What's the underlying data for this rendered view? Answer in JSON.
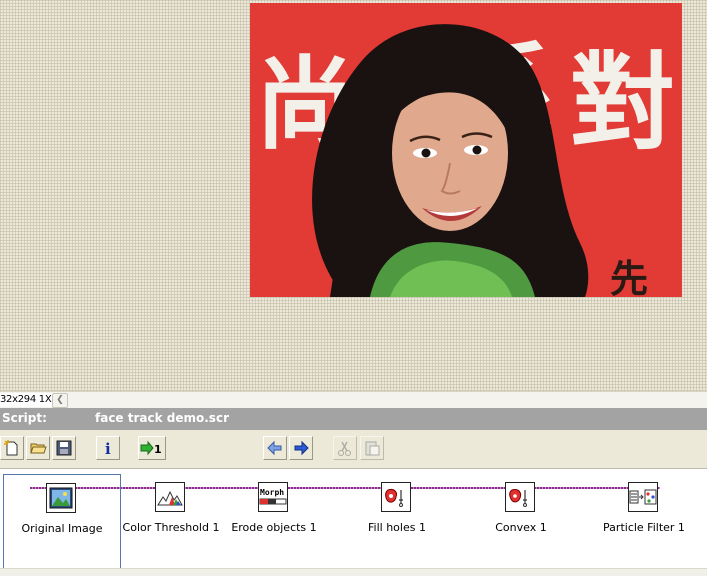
{
  "viewer": {
    "image_alt": "photo",
    "zoom_readout": "32x294 1X"
  },
  "script": {
    "label": "Script:",
    "filename": "face track demo.scr"
  },
  "toolbar": {
    "buttons": [
      "new-script",
      "open-script",
      "save-script",
      "info",
      "run-script",
      "step-back",
      "step-forward",
      "cut",
      "paste-step"
    ]
  },
  "steps": [
    {
      "label": "Original Image",
      "icon": "original-image-icon"
    },
    {
      "label": "Color Threshold 1",
      "icon": "color-threshold-icon"
    },
    {
      "label": "Erode objects 1",
      "icon": "morph-icon",
      "icon_text": "Morph"
    },
    {
      "label": "Fill holes 1",
      "icon": "fill-holes-icon"
    },
    {
      "label": "Convex 1",
      "icon": "convex-icon"
    },
    {
      "label": "Particle Filter 1",
      "icon": "particle-filter-icon"
    }
  ],
  "colors": {
    "script_bar": "#a3a3a3",
    "photo_background": "#e23a34",
    "chain_line": "#8a2a8a",
    "selection_border": "#5577aa"
  }
}
